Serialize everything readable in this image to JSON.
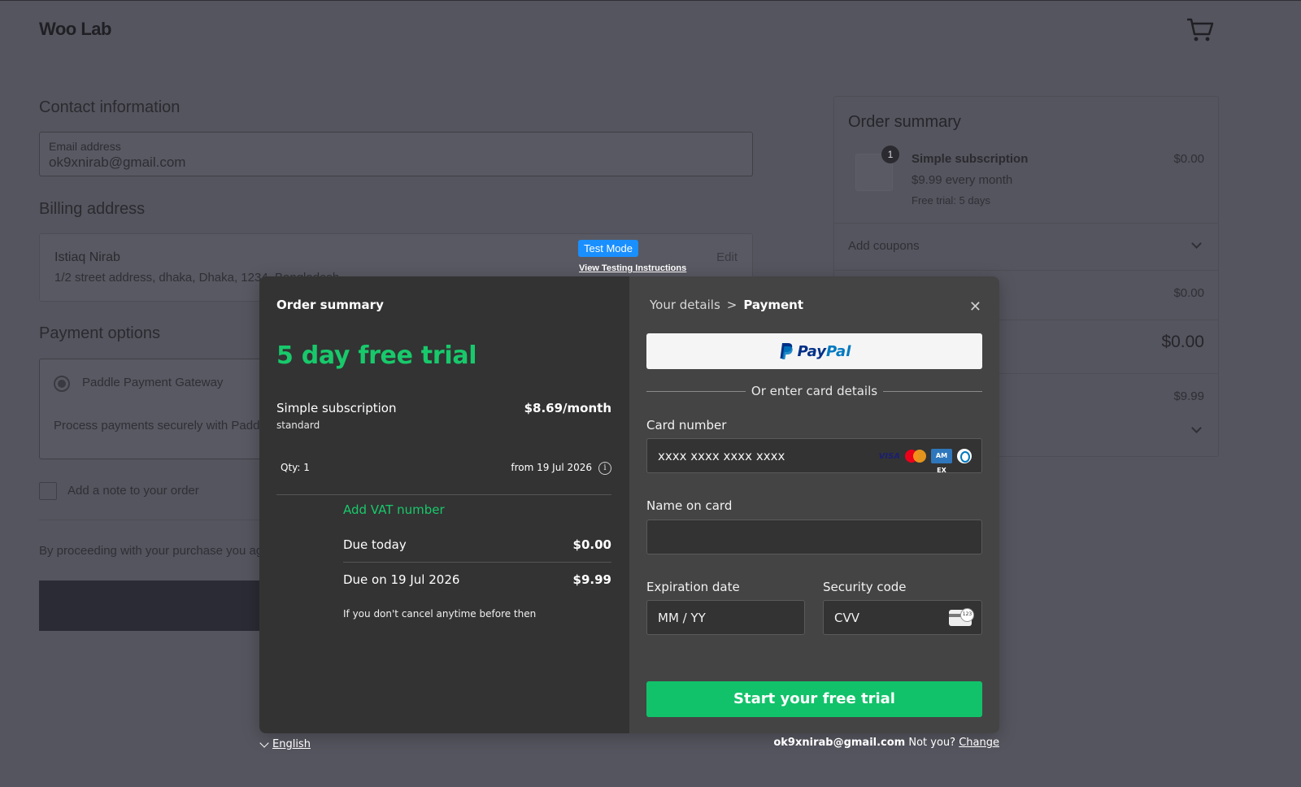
{
  "site": {
    "brand": "Woo Lab"
  },
  "contact": {
    "title": "Contact information",
    "email_label": "Email address",
    "email_value": "ok9xnirab@gmail.com"
  },
  "billing": {
    "title": "Billing address",
    "name": "Istiaq Nirab",
    "address": "1/2 street address, dhaka, Dhaka, 1234, Bangladesh",
    "edit_label": "Edit"
  },
  "test_mode": {
    "badge": "Test Mode",
    "link": "View Testing Instructions"
  },
  "payment_options": {
    "title": "Payment options",
    "gateway": "Paddle Payment Gateway",
    "description": "Process payments securely with Paddle"
  },
  "order_note": {
    "label": "Add a note to your order"
  },
  "terms": "By proceeding with your purchase you agree",
  "side_summary": {
    "title": "Order summary",
    "qty_badge": "1",
    "item_name": "Simple subscription",
    "item_price": "$0.00",
    "item_recurring": "$9.99 every month",
    "item_trial": "Free trial: 5 days",
    "coupons_label": "Add coupons",
    "subtotal_value": "$0.00",
    "total_value": "$0.00",
    "recurring_value": "$9.99"
  },
  "modal": {
    "left": {
      "title": "Order summary",
      "trial_headline": "5 day free trial",
      "product_name": "Simple subscription",
      "product_price": "$8.69/month",
      "product_plan": "standard",
      "qty": "Qty: 1",
      "from_date": "from 19 Jul 2026",
      "info_glyph": "i",
      "vat_link": "Add VAT number",
      "due_today_label": "Due today",
      "due_today_value": "$0.00",
      "due_later_label": "Due on 19 Jul 2026",
      "due_later_value": "$9.99",
      "cancel_note": "If you don't cancel anytime before then"
    },
    "right": {
      "crumb_details": "Your details",
      "crumb_sep": ">",
      "crumb_payment": "Payment",
      "close_glyph": "✕",
      "paypal_pay": "Pay",
      "paypal_pal": "Pal",
      "or_text": "Or enter card details",
      "card_number_label": "Card number",
      "card_number_placeholder": "xxxx xxxx xxxx xxxx",
      "card_brands": [
        "visa-icon",
        "mastercard-icon",
        "amex-icon",
        "diners-icon"
      ],
      "visa_text": "VISA",
      "amex_text": "AM EX",
      "name_label": "Name on card",
      "name_placeholder": "",
      "expiry_label": "Expiration date",
      "expiry_placeholder": "MM / YY",
      "security_label": "Security code",
      "security_placeholder": "CVV",
      "submit_label": "Start your free trial"
    }
  },
  "footer": {
    "language": "English",
    "account_email": "ok9xnirab@gmail.com",
    "not_you": "Not you?",
    "change_link": "Change"
  },
  "colors": {
    "overlay_bg": "#55555f",
    "modal_left_bg": "#333333",
    "modal_right_bg": "#444444",
    "accent_green": "#12c26a",
    "test_mode_blue": "#1a8fff"
  }
}
